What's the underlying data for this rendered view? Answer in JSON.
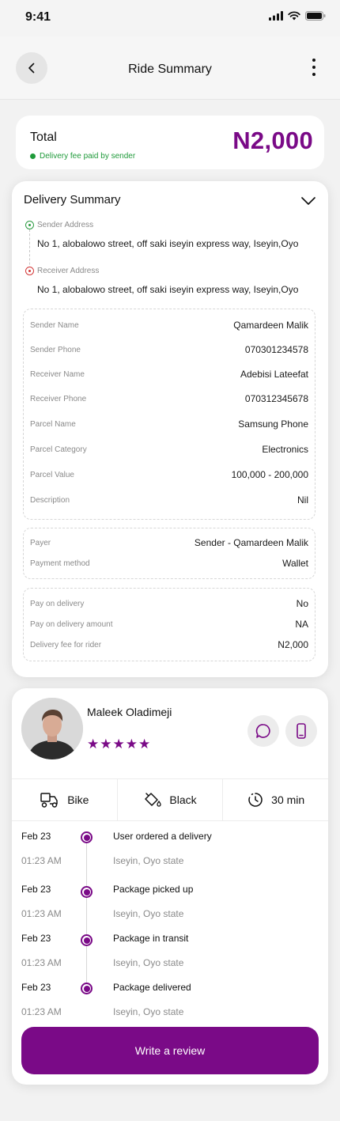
{
  "status_bar": {
    "time": "9:41"
  },
  "header": {
    "title": "Ride Summary"
  },
  "total": {
    "label": "Total",
    "note": "Delivery fee paid by sender",
    "amount": "N2,000",
    "accent_color": "#7a0a87",
    "note_color": "#1f9a3a"
  },
  "summary": {
    "title": "Delivery Summary",
    "sender_address_label": "Sender Address",
    "sender_address": "No 1, alobalowo street, off saki iseyin express way, Iseyin,Oyo",
    "receiver_address_label": "Receiver Address",
    "receiver_address": "No 1, alobalowo street, off saki iseyin express way, Iseyin,Oyo",
    "details": [
      {
        "label": "Sender Name",
        "value": "Qamardeen Malik"
      },
      {
        "label": "Sender Phone",
        "value": "070301234578"
      },
      {
        "label": "Receiver Name",
        "value": "Adebisi Lateefat"
      },
      {
        "label": "Receiver Phone",
        "value": "070312345678"
      },
      {
        "label": "Parcel Name",
        "value": "Samsung Phone"
      },
      {
        "label": "Parcel Category",
        "value": "Electronics"
      },
      {
        "label": "Parcel Value",
        "value": "100,000 - 200,000"
      },
      {
        "label": "Description",
        "value": "Nil"
      }
    ],
    "payment": [
      {
        "label": "Payer",
        "value": "Sender - Qamardeen Malik"
      },
      {
        "label": "Payment method",
        "value": "Wallet"
      }
    ],
    "delivery": [
      {
        "label": "Pay on delivery",
        "value": "No"
      },
      {
        "label": "Pay on delivery amount",
        "value": "NA"
      },
      {
        "label": "Delivery fee for rider",
        "value": "N2,000"
      }
    ]
  },
  "rider": {
    "name": "Maleek Oladimeji",
    "rating": 5,
    "vehicle": "Bike",
    "color": "Black",
    "eta": "30 min"
  },
  "timeline": [
    {
      "date": "Feb 23",
      "time": "01:23 AM",
      "title": "User ordered a delivery",
      "location": "Iseyin, Oyo state"
    },
    {
      "date": "Feb 23",
      "time": "01:23 AM",
      "title": "Package picked up",
      "location": "Iseyin, Oyo state"
    },
    {
      "date": "Feb 23",
      "time": "01:23 AM",
      "title": "Package in transit",
      "location": "Iseyin, Oyo state"
    },
    {
      "date": "Feb 23",
      "time": "01:23 AM",
      "title": "Package delivered",
      "location": "Iseyin, Oyo state"
    }
  ],
  "review_button": "Write a review"
}
